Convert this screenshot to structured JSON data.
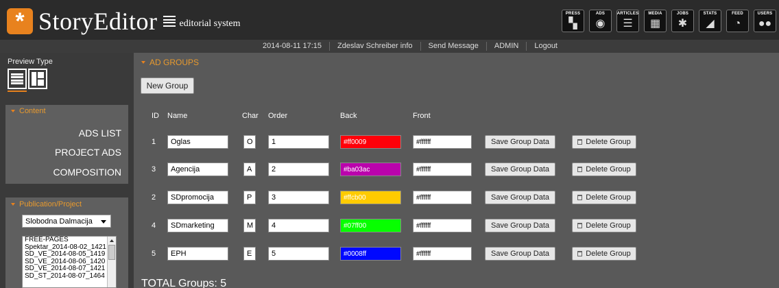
{
  "app": {
    "logo_mark": "*",
    "name": "StoryEditor",
    "subtitle": "editorial system"
  },
  "nav": [
    {
      "label": "PRESS",
      "icon": "press-icon",
      "glyph": "▚"
    },
    {
      "label": "ADS",
      "icon": "ads-icon",
      "glyph": "◉"
    },
    {
      "label": "ARTICLES",
      "icon": "articles-icon",
      "glyph": "☰"
    },
    {
      "label": "MEDIA",
      "icon": "media-icon",
      "glyph": "▦"
    },
    {
      "label": "JOBS",
      "icon": "jobs-icon",
      "glyph": "✱"
    },
    {
      "label": "STATS",
      "icon": "stats-icon",
      "glyph": "◢"
    },
    {
      "label": "FEED",
      "icon": "feed-icon",
      "glyph": "◔"
    },
    {
      "label": "USERS",
      "icon": "users-icon",
      "glyph": "●●"
    }
  ],
  "status": {
    "datetime": "2014-08-11 17:15",
    "user": "Zdeslav Schreiber info",
    "send_message": "Send Message",
    "admin": "ADMIN",
    "logout": "Logout"
  },
  "sidebar": {
    "preview_type": "Preview Type",
    "content": {
      "title": "Content",
      "links": [
        "ADS LIST",
        "PROJECT ADS",
        "COMPOSITION"
      ]
    },
    "publication": {
      "title": "Publication/Project",
      "selected": "Slobodna Dalmacija",
      "items": [
        "FREE-PAGES",
        "Spektar_2014-08-02_1421",
        "SD_VE_2014-08-05_1419",
        "SD_VE_2014-08-06_1420",
        "SD_VE_2014-08-07_1421",
        "SD_ST_2014-08-07_1464"
      ]
    }
  },
  "main": {
    "section_title": "AD GROUPS",
    "new_group": "New Group",
    "columns": {
      "id": "ID",
      "name": "Name",
      "char": "Char",
      "order": "Order",
      "back": "Back",
      "front": "Front"
    },
    "save_label": "Save Group Data",
    "delete_label": "Delete Group",
    "rows": [
      {
        "id": "1",
        "name": "Oglas",
        "char": "O",
        "order": "1",
        "back": "#ff0009",
        "front": "#ffffff"
      },
      {
        "id": "3",
        "name": "Agencija",
        "char": "A",
        "order": "2",
        "back": "#ba03ac",
        "front": "#ffffff"
      },
      {
        "id": "2",
        "name": "SDpromocija",
        "char": "P",
        "order": "3",
        "back": "#ffcb00",
        "front": "#ffffff"
      },
      {
        "id": "4",
        "name": "SDmarketing",
        "char": "M",
        "order": "4",
        "back": "#07ff00",
        "front": "#ffffff"
      },
      {
        "id": "5",
        "name": "EPH",
        "char": "E",
        "order": "5",
        "back": "#0008ff",
        "front": "#ffffff"
      }
    ],
    "total": "TOTAL Groups: 5"
  },
  "colors": {
    "accent": "#e8821e",
    "header_bg": "#2b2b2b",
    "sidebar_bg": "#3a3a3a",
    "main_bg": "#595959"
  }
}
